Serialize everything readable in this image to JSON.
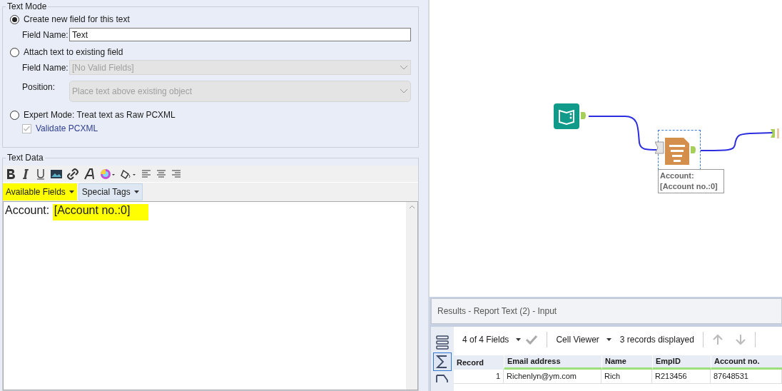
{
  "text_mode": {
    "legend": "Text Mode",
    "options": [
      {
        "kind": "new",
        "label": "Create new field for this text",
        "selected": true
      },
      {
        "kind": "attach",
        "label": "Attach text to existing field",
        "selected": false
      },
      {
        "kind": "expert",
        "label": "Expert Mode: Treat text as Raw PCXML",
        "selected": false
      }
    ],
    "field_name": {
      "label": "Field Name:",
      "value": "Text"
    },
    "existing_field": {
      "label": "Field Name:",
      "value": "[No Valid Fields]",
      "disabled": true
    },
    "position": {
      "label": "Position:",
      "value": "Place text above existing object",
      "disabled": true
    },
    "validate": {
      "label": "Validate PCXML",
      "checked": true,
      "disabled": true
    }
  },
  "text_data": {
    "legend": "Text Data",
    "menus": [
      {
        "label": "Available Fields",
        "highlighted": true
      },
      {
        "label": "Special Tags",
        "highlighted": false
      }
    ],
    "content": [
      {
        "text": "Account: ",
        "highlighted": false
      },
      {
        "text": "[Account no.:0]",
        "highlighted": true
      }
    ]
  },
  "canvas": {
    "node_annotation": [
      "Account:",
      "[Account no.:0]"
    ]
  },
  "results": {
    "title": "Results - Report Text (2) - Input",
    "fields": "4 of 4 Fields",
    "viewer": "Cell Viewer",
    "records": "3 records displayed",
    "columns": [
      "Record",
      "Email address",
      "Name",
      "EmpID",
      "Account no."
    ],
    "rows": [
      [
        "1",
        "Richenlyn@ym.com",
        "Rich",
        "R213456",
        "87648531"
      ]
    ]
  }
}
